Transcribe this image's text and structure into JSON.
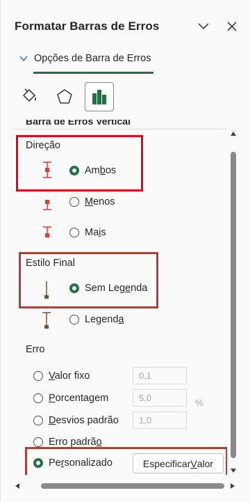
{
  "pane": {
    "title": "Formatar Barras de Erros",
    "section_tab": "Opções de Barra de Erros",
    "icon_tabs": [
      "fill-line-icon",
      "effects-icon",
      "bar-options-icon"
    ]
  },
  "section": {
    "cut_heading": "Barra de Erros Vertical"
  },
  "direction": {
    "label": "Direção",
    "options": [
      {
        "pre": "Am",
        "ul": "b",
        "post": "os",
        "selected": true
      },
      {
        "pre": "",
        "ul": "M",
        "post": "enos",
        "selected": false
      },
      {
        "pre": "Ma",
        "ul": "i",
        "post": "s",
        "selected": false
      }
    ]
  },
  "end_style": {
    "label": "Estilo Final",
    "options": [
      {
        "pre": "Sem Leg",
        "ul": "e",
        "post": "nda",
        "selected": true
      },
      {
        "pre": "Legend",
        "ul": "a",
        "post": "",
        "selected": false
      }
    ]
  },
  "error": {
    "label": "Erro",
    "options": [
      {
        "pre": "",
        "ul": "V",
        "post": "alor fixo",
        "value": "0,1",
        "selected": false
      },
      {
        "pre": "",
        "ul": "P",
        "post": "orcentagem",
        "value": "5,0",
        "selected": false
      },
      {
        "pre": "",
        "ul": "D",
        "post": "esvios padrão",
        "value": "1,0",
        "selected": false
      },
      {
        "pre": "Erro padrã",
        "ul": "o",
        "post": "",
        "selected": false
      },
      {
        "pre": "Pe",
        "ul": "r",
        "post": "sonalizado",
        "selected": true
      }
    ],
    "percent_unit": "%",
    "specify_pre": "Especificar ",
    "specify_ul": "V",
    "specify_post": "alor"
  },
  "colors": {
    "accent_green": "#217346",
    "highlight_red": "#e8001c",
    "highlight_brown": "#a6463a",
    "errbar_red": "#e03c31",
    "errbar_brown": "#7a5230"
  }
}
